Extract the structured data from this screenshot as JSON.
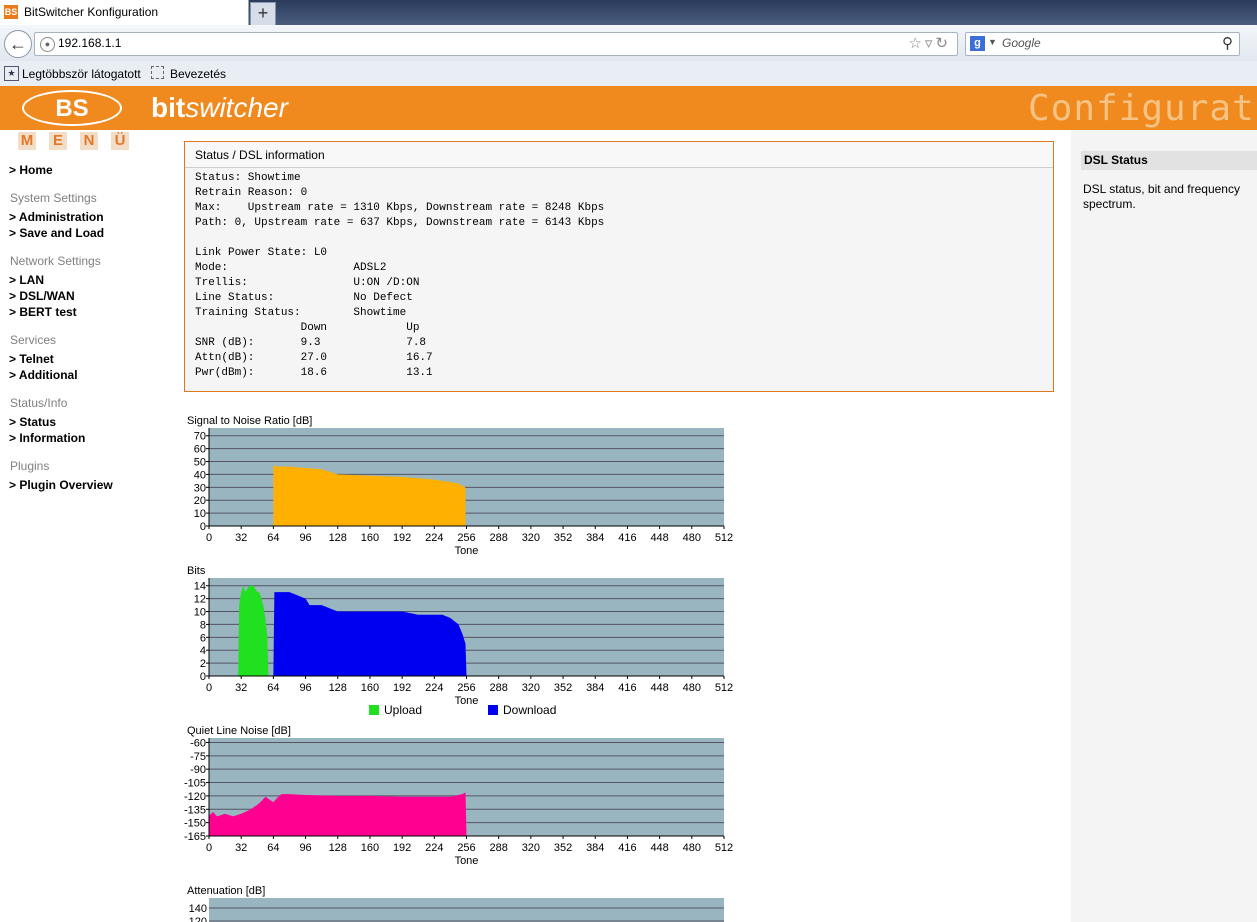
{
  "browser": {
    "tab_title": "BitSwitcher Konfiguration",
    "favicon_text": "BS",
    "new_tab_label": "+",
    "url": "192.168.1.1",
    "search_placeholder": "Google",
    "bookmarks": [
      "Legtöbbször látogatott",
      "Bevezetés"
    ]
  },
  "header": {
    "logo": "BS",
    "brand_bold": "bit",
    "brand_italic": "switcher",
    "config_label": "Configuration"
  },
  "menu": {
    "letters": [
      "M",
      "E",
      "N",
      "Ü"
    ],
    "home": "> Home",
    "sections": [
      {
        "title": "System Settings",
        "items": [
          "> Administration",
          "> Save and Load"
        ]
      },
      {
        "title": "Network Settings",
        "items": [
          "> LAN",
          "> DSL/WAN",
          "> BERT test"
        ]
      },
      {
        "title": "Services",
        "items": [
          "> Telnet",
          "> Additional"
        ]
      },
      {
        "title": "Status/Info",
        "items": [
          "> Status",
          "> Information"
        ]
      },
      {
        "title": "Plugins",
        "items": [
          "> Plugin Overview"
        ]
      }
    ]
  },
  "right_panel": {
    "title": "DSL Status",
    "description": "DSL status, bit and frequency spectrum."
  },
  "status_box": {
    "title": "Status / DSL information",
    "lines": [
      "Status: Showtime",
      "Retrain Reason: 0",
      "Max:    Upstream rate = 1310 Kbps, Downstream rate = 8248 Kbps",
      "Path: 0, Upstream rate = 637 Kbps, Downstream rate = 6143 Kbps",
      "",
      "Link Power State: L0",
      "Mode:                   ADSL2",
      "Trellis:                U:ON /D:ON",
      "Line Status:            No Defect",
      "Training Status:        Showtime",
      "                Down            Up",
      "SNR (dB):       9.3             7.8",
      "Attn(dB):       27.0            16.7",
      "Pwr(dBm):       18.6            13.1"
    ]
  },
  "chart_data": [
    {
      "type": "area",
      "title": "Signal to Noise Ratio [dB]",
      "xlabel": "Tone",
      "xticks": [
        0,
        32,
        64,
        96,
        128,
        160,
        192,
        224,
        256,
        288,
        320,
        352,
        384,
        416,
        448,
        480,
        512
      ],
      "yticks": [
        0,
        10,
        20,
        30,
        40,
        50,
        60,
        70
      ],
      "ylim": [
        0,
        76
      ],
      "grid": true,
      "series": [
        {
          "color": "#ffb000",
          "x": [
            64,
            68,
            80,
            96,
            112,
            128,
            160,
            192,
            208,
            224,
            240,
            248,
            252,
            255
          ],
          "values": [
            47,
            46,
            46,
            45,
            44,
            40,
            39,
            38,
            37,
            36,
            34,
            33,
            31,
            30
          ]
        }
      ]
    },
    {
      "type": "area",
      "title": "Bits",
      "xlabel": "Tone",
      "xticks": [
        0,
        32,
        64,
        96,
        128,
        160,
        192,
        224,
        256,
        288,
        320,
        352,
        384,
        416,
        448,
        480,
        512
      ],
      "yticks": [
        0,
        2,
        4,
        6,
        8,
        10,
        12,
        14
      ],
      "ylim": [
        0,
        15.2
      ],
      "grid": true,
      "series": [
        {
          "name": "Upload",
          "color": "#20e020",
          "x": [
            29,
            30,
            32,
            34,
            36,
            40,
            44,
            48,
            50,
            52,
            54,
            56,
            58,
            59
          ],
          "values": [
            0,
            11,
            13,
            14,
            13,
            14,
            14,
            13,
            13,
            12,
            11,
            9,
            6,
            0
          ]
        },
        {
          "name": "Download",
          "color": "#0000f0",
          "x": [
            64,
            65,
            80,
            96,
            100,
            112,
            128,
            160,
            192,
            208,
            224,
            232,
            240,
            244,
            248,
            252,
            255,
            256
          ],
          "values": [
            0,
            13,
            13,
            12,
            11,
            11,
            10,
            10,
            10,
            9.5,
            9.5,
            9.5,
            9,
            8.5,
            8,
            6.5,
            5,
            0
          ]
        }
      ]
    },
    {
      "type": "area",
      "title": "Quiet Line Noise [dB]",
      "xlabel": "Tone",
      "xticks": [
        0,
        32,
        64,
        96,
        128,
        160,
        192,
        224,
        256,
        288,
        320,
        352,
        384,
        416,
        448,
        480,
        512
      ],
      "yticks": [
        -60,
        -75,
        -90,
        -105,
        -120,
        -135,
        -150,
        -165
      ],
      "ylim": [
        -165,
        -55
      ],
      "grid": true,
      "series": [
        {
          "color": "#ff0090",
          "x": [
            0,
            4,
            8,
            16,
            24,
            32,
            40,
            48,
            52,
            56,
            60,
            64,
            68,
            72,
            80,
            96,
            128,
            160,
            192,
            224,
            240,
            252,
            255,
            256
          ],
          "values": [
            -142,
            -138,
            -143,
            -140,
            -143,
            -140,
            -136,
            -130,
            -126,
            -121,
            -124,
            -127,
            -122,
            -118,
            -118,
            -119,
            -120,
            -120,
            -121,
            -121,
            -121,
            -118,
            -116,
            -165
          ]
        }
      ]
    },
    {
      "type": "area",
      "title": "Attenuation [dB]",
      "yticks": [
        140,
        120
      ],
      "grid": true,
      "series": []
    }
  ]
}
